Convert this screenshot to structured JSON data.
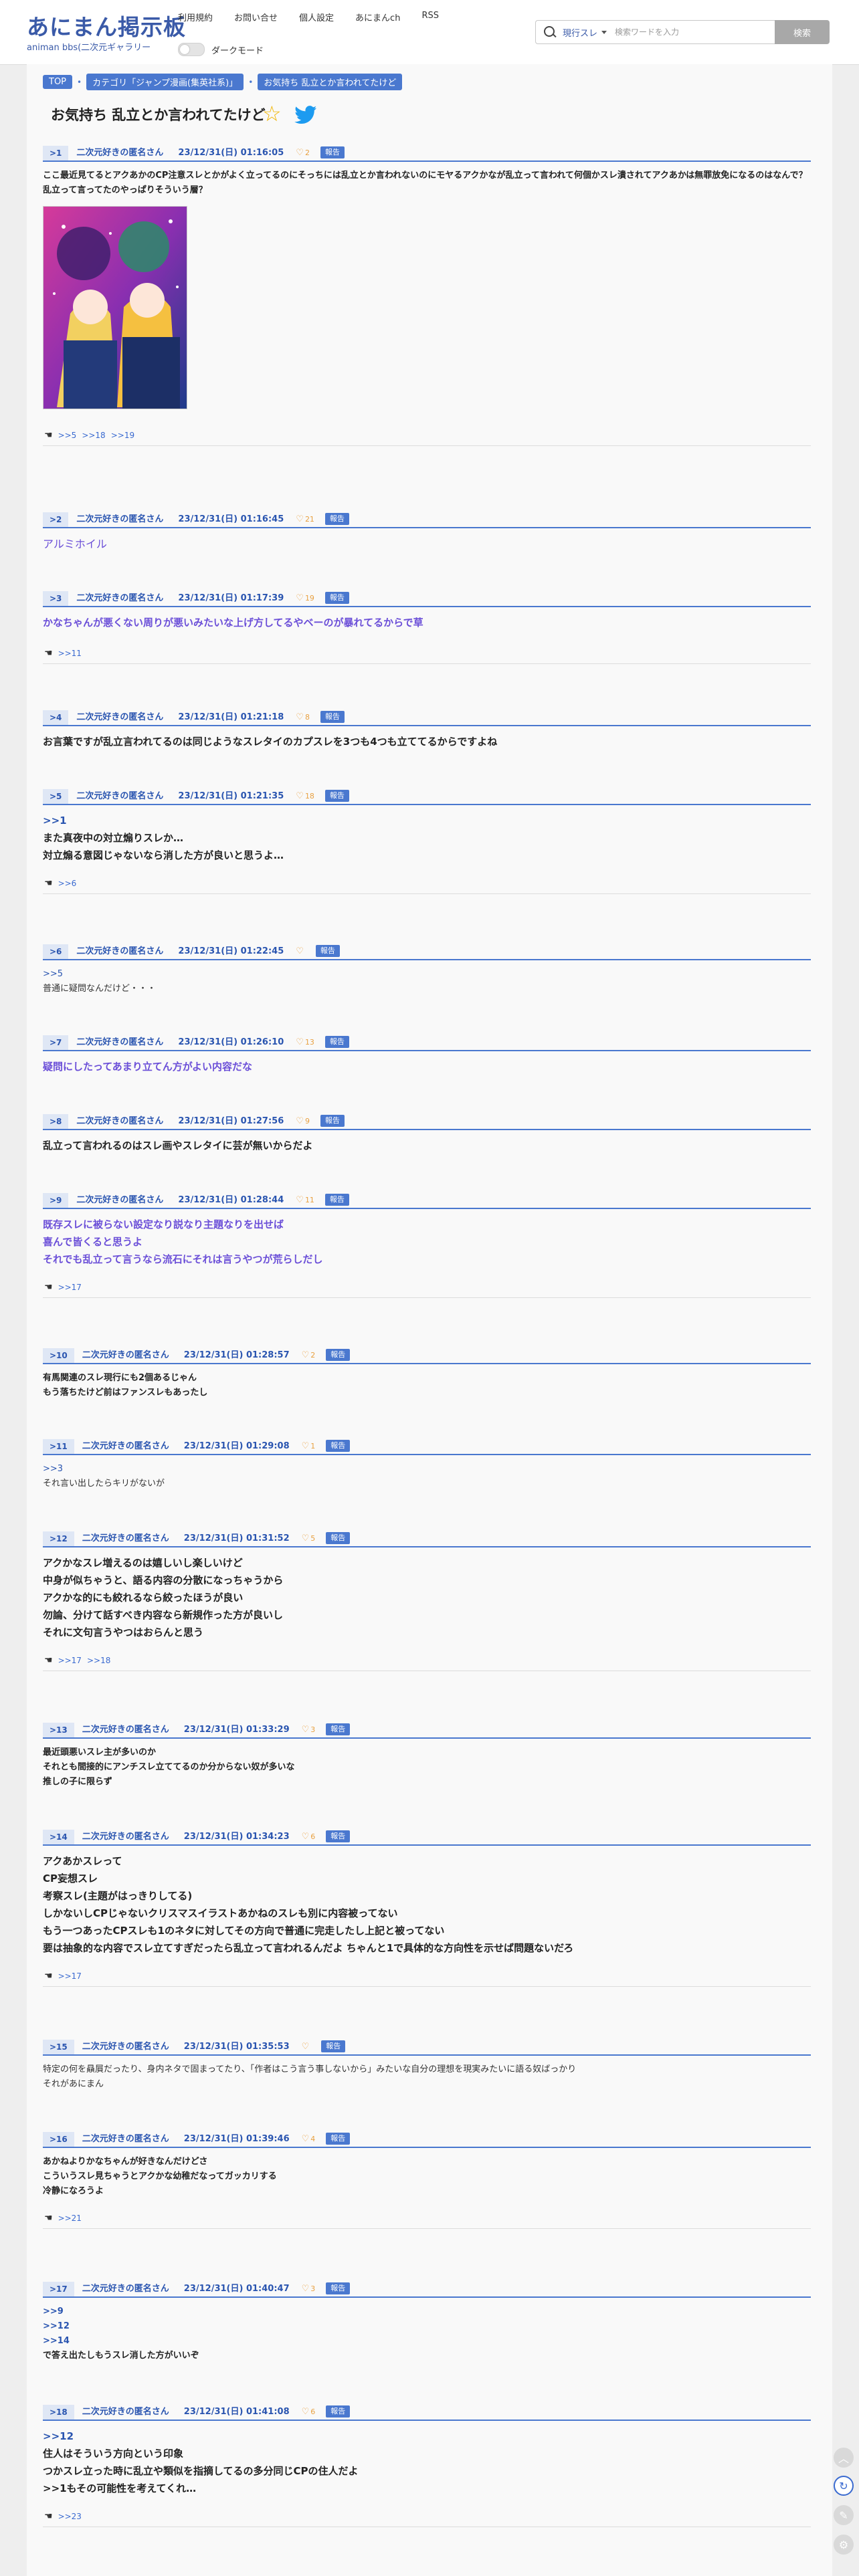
{
  "site": {
    "logo": "あにまん掲示板",
    "logo_sub": "animan bbs(二次元ギャラリー",
    "nav": [
      "利用規約",
      "お問い合せ",
      "個人設定",
      "あにまんch",
      "RSS"
    ],
    "dark_mode_label": "ダークモード",
    "search": {
      "select": "現行スレ",
      "placeholder": "検索ワードを入力",
      "button": "検索"
    }
  },
  "breadcrumbs": [
    "TOP",
    "カテゴリ「ジャンプ漫画(集英社系)」",
    "お気持ち 乱立とか言われてたけど"
  ],
  "thread_title": "お気持ち 乱立とか言われてたけど",
  "poster_name": "二次元好きの匿名さん",
  "report_label": "報告",
  "colors": {
    "accent": "#4a78cf",
    "link": "#6b4fd8",
    "heart": "#e8a040"
  },
  "posts": [
    {
      "num": ">1",
      "date": "23/12/31(日) 01:16:05",
      "likes": "2",
      "lines": [
        "ここ最近見てるとアクあかのCP注意スレとかがよく立ってるのにそっちには乱立とか言われないのにモヤるアクかなが乱立って言われて何個かスレ潰されてアクあかは無罪放免になるのはなんで？乱立って言ってたのやっぱりそういう層？"
      ],
      "replies": [
        ">>5",
        ">>18",
        ">>19"
      ]
    },
    {
      "num": ">2",
      "date": "23/12/31(日) 01:16:45",
      "likes": "21",
      "lines": [
        "アルミホイル"
      ],
      "replies": []
    },
    {
      "num": ">3",
      "date": "23/12/31(日) 01:17:39",
      "likes": "19",
      "lines": [
        "かなちゃんが悪くない周りが悪いみたいな上げ方してるやベーのが暴れてるからで草"
      ],
      "replies": [
        ">>11"
      ]
    },
    {
      "num": ">4",
      "date": "23/12/31(日) 01:21:18",
      "likes": "8",
      "lines": [
        "お言葉ですが乱立言われてるのは同じようなスレタイのカプスレを3つも4つも立ててるからですよね"
      ],
      "replies": []
    },
    {
      "num": ">5",
      "date": "23/12/31(日) 01:21:35",
      "likes": "18",
      "lines": [
        ">>1",
        "また真夜中の対立煽りスレか…",
        "対立煽る意図じゃないなら消した方が良いと思うよ…"
      ],
      "replies": [
        ">>6"
      ]
    },
    {
      "num": ">6",
      "date": "23/12/31(日) 01:22:45",
      "likes": "",
      "lines": [
        ">>5",
        "普通に疑問なんだけど・・・"
      ],
      "replies": []
    },
    {
      "num": ">7",
      "date": "23/12/31(日) 01:26:10",
      "likes": "13",
      "lines": [
        "疑問にしたってあまり立てん方がよい内容だな"
      ],
      "replies": []
    },
    {
      "num": ">8",
      "date": "23/12/31(日) 01:27:56",
      "likes": "9",
      "lines": [
        "乱立って言われるのはスレ画やスレタイに芸が無いからだよ"
      ],
      "replies": []
    },
    {
      "num": ">9",
      "date": "23/12/31(日) 01:28:44",
      "likes": "11",
      "lines": [
        "既存スレに被らない設定なり説なり主題なりを出せば",
        "喜んで皆くると思うよ",
        "それでも乱立って言うなら流石にそれは言うやつが荒らしだし"
      ],
      "replies": [
        ">>17"
      ]
    },
    {
      "num": ">10",
      "date": "23/12/31(日) 01:28:57",
      "likes": "2",
      "lines": [
        "有馬関連のスレ現行にも2個あるじゃん",
        "もう落ちたけど前はファンスレもあったし"
      ],
      "replies": []
    },
    {
      "num": ">11",
      "date": "23/12/31(日) 01:29:08",
      "likes": "1",
      "lines": [
        ">>3",
        "それ言い出したらキリがないが"
      ],
      "replies": []
    },
    {
      "num": ">12",
      "date": "23/12/31(日) 01:31:52",
      "likes": "5",
      "lines": [
        "アクかなスレ増えるのは嬉しいし楽しいけど",
        "中身が似ちゃうと、語る内容の分散になっちゃうから",
        "アクかな的にも絞れるなら絞ったほうが良い",
        "勿論、分けて話すべき内容なら新規作った方が良いし",
        "それに文句言うやつはおらんと思う"
      ],
      "replies": [
        ">>17",
        ">>18"
      ]
    },
    {
      "num": ">13",
      "date": "23/12/31(日) 01:33:29",
      "likes": "3",
      "lines": [
        "最近頭悪いスレ主が多いのか",
        "それとも間接的にアンチスレ立ててるのか分からない奴が多いな",
        "推しの子に限らず"
      ],
      "replies": []
    },
    {
      "num": ">14",
      "date": "23/12/31(日) 01:34:23",
      "likes": "6",
      "lines": [
        "アクあかスレって",
        "CP妄想スレ",
        "考察スレ(主題がはっきりしてる)",
        "しかないしCPじゃないクリスマスイラストあかねのスレも別に内容被ってない",
        "もう一つあったCPスレも1のネタに対してその方向で普通に完走したし上記と被ってない",
        "要は抽象的な内容でスレ立てすぎだったら乱立って言われるんだよ ちゃんと1で具体的な方向性を示せば問題ないだろ"
      ],
      "replies": [
        ">>17"
      ]
    },
    {
      "num": ">15",
      "date": "23/12/31(日) 01:35:53",
      "likes": "",
      "lines": [
        "特定の何を贔屓だったり、身内ネタで固まってたり、「作者はこう言う事しないから」みたいな自分の理想を現実みたいに語る奴ばっかり",
        "それがあにまん"
      ],
      "replies": []
    },
    {
      "num": ">16",
      "date": "23/12/31(日) 01:39:46",
      "likes": "4",
      "lines": [
        "あかねよりかなちゃんが好きなんだけどさ",
        "こういうスレ見ちゃうとアクかな幼稚だなってガッカリする",
        "冷静になろうよ"
      ],
      "replies": [
        ">>21"
      ]
    },
    {
      "num": ">17",
      "date": "23/12/31(日) 01:40:47",
      "likes": "3",
      "lines": [
        ">>9",
        ">>12",
        ">>14",
        "で答え出たしもうスレ消した方がいいぞ"
      ],
      "replies": []
    },
    {
      "num": ">18",
      "date": "23/12/31(日) 01:41:08",
      "likes": "6",
      "lines": [
        ">>12",
        "住人はそういう方向という印象",
        "つかスレ立った時に乱立や類似を指摘してるの多分同じCPの住人だよ",
        ">>1もその可能性を考えてくれ…"
      ],
      "replies": [
        ">>23"
      ]
    }
  ]
}
